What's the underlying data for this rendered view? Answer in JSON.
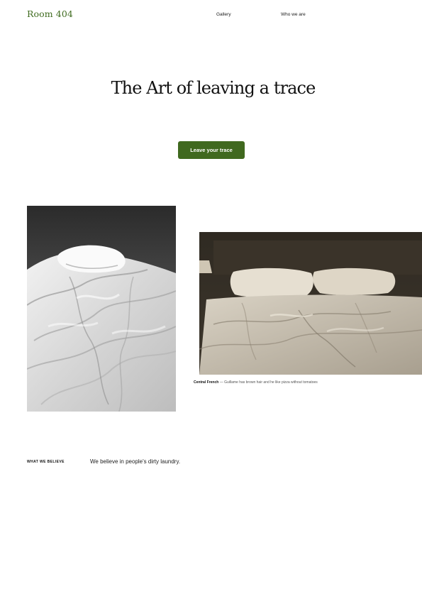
{
  "header": {
    "logo": "Room 404",
    "nav": [
      {
        "label": "Gallery"
      },
      {
        "label": "Who we are"
      }
    ]
  },
  "hero": {
    "title": "The Art of leaving a trace",
    "cta_label": "Leave your trace",
    "cta_color": "#40691f"
  },
  "gallery": {
    "caption_title": "Central French",
    "caption_text": " — Guillame has brown hair and he like pizza without tomatoes"
  },
  "beliefs": {
    "label": "WHAT WE BELIEVE",
    "text": "We believe in people's dirty laundry."
  },
  "colors": {
    "brand": "#3f6b1f"
  }
}
